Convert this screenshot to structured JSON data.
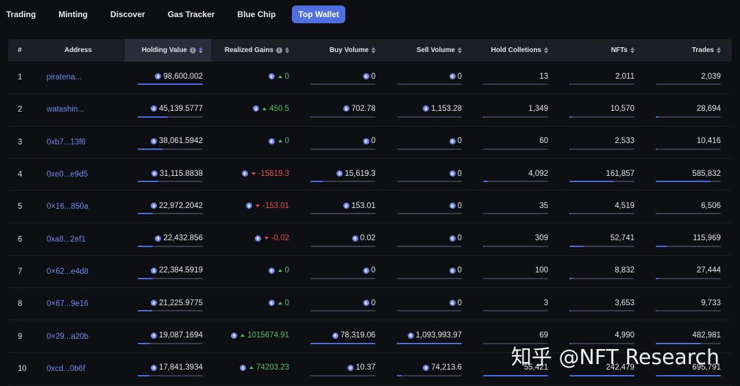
{
  "nav": {
    "tabs": [
      {
        "label": "Trading",
        "active": false
      },
      {
        "label": "Minting",
        "active": false
      },
      {
        "label": "Discover",
        "active": false
      },
      {
        "label": "Gas Tracker",
        "active": false
      },
      {
        "label": "Blue Chip",
        "active": false
      },
      {
        "label": "Top Wallet",
        "active": true
      }
    ]
  },
  "table": {
    "headers": {
      "rank": "#",
      "address": "Address",
      "holding_value": "Holding Value",
      "realized_gains": "Realized Gains",
      "buy_volume": "Buy Volume",
      "sell_volume": "Sell Volume",
      "hold_collections": "Hold Colletions",
      "nfts": "NFTs",
      "trades": "Trades"
    },
    "rows": [
      {
        "rank": "1",
        "address": "piratena...",
        "holding_value": "98,600.002",
        "holding_bar": 1.0,
        "realized_gains": "0",
        "gain_dir": "up",
        "buy_volume": "0",
        "buy_bar": 0.0,
        "sell_volume": "0",
        "sell_bar": 0.0,
        "hold_collections": "13",
        "coll_bar": 0.0,
        "nfts": "2,011",
        "nft_bar": 0.01,
        "trades": "2,039",
        "trade_bar": 0.0
      },
      {
        "rank": "2",
        "address": "watashin...",
        "holding_value": "45,139.5777",
        "holding_bar": 0.46,
        "realized_gains": "450.5",
        "gain_dir": "up",
        "buy_volume": "702.78",
        "buy_bar": 0.01,
        "sell_volume": "1,153.28",
        "sell_bar": 0.0,
        "hold_collections": "1,349",
        "coll_bar": 0.02,
        "nfts": "10,570",
        "nft_bar": 0.04,
        "trades": "28,694",
        "trade_bar": 0.05
      },
      {
        "rank": "3",
        "address": "0xb7...13f6",
        "holding_value": "38,061.5942",
        "holding_bar": 0.39,
        "realized_gains": "0",
        "gain_dir": "up",
        "buy_volume": "0",
        "buy_bar": 0.0,
        "sell_volume": "0",
        "sell_bar": 0.0,
        "hold_collections": "60",
        "coll_bar": 0.0,
        "nfts": "2,533",
        "nft_bar": 0.01,
        "trades": "10,416",
        "trade_bar": 0.02
      },
      {
        "rank": "4",
        "address": "0xe0...e9d5",
        "holding_value": "31,115.8838",
        "holding_bar": 0.32,
        "realized_gains": "-15619.3",
        "gain_dir": "down",
        "buy_volume": "15,619.3",
        "buy_bar": 0.2,
        "sell_volume": "0",
        "sell_bar": 0.0,
        "hold_collections": "4,092",
        "coll_bar": 0.07,
        "nfts": "161,857",
        "nft_bar": 0.67,
        "trades": "585,832",
        "trade_bar": 0.84
      },
      {
        "rank": "5",
        "address": "0×16...850a",
        "holding_value": "22,972.2042",
        "holding_bar": 0.23,
        "realized_gains": "-153.01",
        "gain_dir": "down",
        "buy_volume": "153.01",
        "buy_bar": 0.0,
        "sell_volume": "0",
        "sell_bar": 0.0,
        "hold_collections": "35",
        "coll_bar": 0.0,
        "nfts": "4,519",
        "nft_bar": 0.02,
        "trades": "6,506",
        "trade_bar": 0.01
      },
      {
        "rank": "6",
        "address": "0xa8...2ef1",
        "holding_value": "22,432.856",
        "holding_bar": 0.23,
        "realized_gains": "-0.02",
        "gain_dir": "down",
        "buy_volume": "0.02",
        "buy_bar": 0.0,
        "sell_volume": "0",
        "sell_bar": 0.0,
        "hold_collections": "309",
        "coll_bar": 0.01,
        "nfts": "52,741",
        "nft_bar": 0.22,
        "trades": "115,969",
        "trade_bar": 0.17
      },
      {
        "rank": "7",
        "address": "0×62...e4d8",
        "holding_value": "22,384.5919",
        "holding_bar": 0.23,
        "realized_gains": "0",
        "gain_dir": "up",
        "buy_volume": "0",
        "buy_bar": 0.0,
        "sell_volume": "0",
        "sell_bar": 0.0,
        "hold_collections": "100",
        "coll_bar": 0.0,
        "nfts": "8,832",
        "nft_bar": 0.04,
        "trades": "27,444",
        "trade_bar": 0.04
      },
      {
        "rank": "8",
        "address": "0×67...9e16",
        "holding_value": "21,225.9775",
        "holding_bar": 0.22,
        "realized_gains": "0",
        "gain_dir": "up",
        "buy_volume": "0",
        "buy_bar": 0.0,
        "sell_volume": "0",
        "sell_bar": 0.0,
        "hold_collections": "3",
        "coll_bar": 0.0,
        "nfts": "3,653",
        "nft_bar": 0.02,
        "trades": "9,733",
        "trade_bar": 0.01
      },
      {
        "rank": "9",
        "address": "0×29...a20b",
        "holding_value": "19,087.1694",
        "holding_bar": 0.19,
        "realized_gains": "1015674.91",
        "gain_dir": "up",
        "buy_volume": "78,319.06",
        "buy_bar": 1.0,
        "sell_volume": "1,093,993.97",
        "sell_bar": 1.0,
        "hold_collections": "69",
        "coll_bar": 0.0,
        "nfts": "4,990",
        "nft_bar": 0.02,
        "trades": "482,981",
        "trade_bar": 0.69
      },
      {
        "rank": "10",
        "address": "0xcd...0b6f",
        "holding_value": "17,841.3934",
        "holding_bar": 0.18,
        "realized_gains": "74203.23",
        "gain_dir": "up",
        "buy_volume": "10.37",
        "buy_bar": 0.0,
        "sell_volume": "74,213.6",
        "sell_bar": 0.07,
        "hold_collections": "55,421",
        "coll_bar": 1.0,
        "nfts": "242,479",
        "nft_bar": 1.0,
        "trades": "695,791",
        "trade_bar": 1.0
      }
    ]
  },
  "watermark": "知乎 @NFT Research",
  "colors": {
    "accent": "#4f6ee0",
    "address_link": "#6b8cf0",
    "gain_positive": "#4cc46c",
    "gain_negative": "#e2525a",
    "bar_fill": "#4c6ee6",
    "bar_track": "#3a3d49"
  }
}
